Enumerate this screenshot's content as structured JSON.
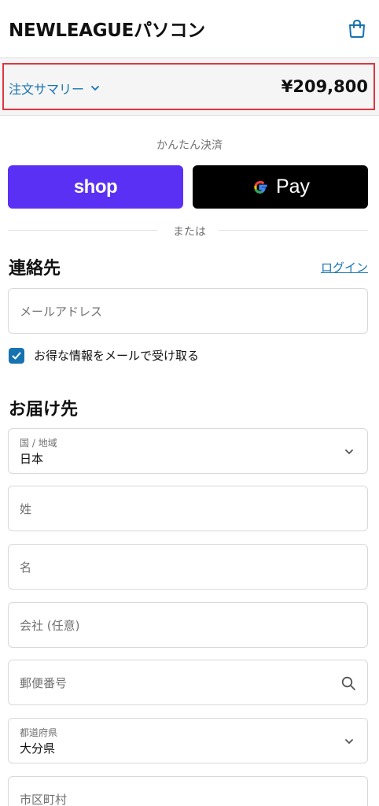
{
  "header": {
    "brand": "NEWLEAGUEパソコン",
    "cart_icon": "shopping-bag-icon"
  },
  "summary": {
    "toggle_label": "注文サマリー",
    "total": "¥209,800"
  },
  "express": {
    "title": "かんたん決済",
    "shop_label": "shop",
    "gpay_label": "Pay",
    "or_text": "または"
  },
  "contact": {
    "title": "連絡先",
    "login_label": "ログイン",
    "email_placeholder": "メールアドレス",
    "marketing_label": "お得な情報をメールで受け取る",
    "marketing_checked": true
  },
  "delivery": {
    "title": "お届け先",
    "country_label": "国 / 地域",
    "country_value": "日本",
    "last_name_placeholder": "姓",
    "first_name_placeholder": "名",
    "company_placeholder": "会社 (任意)",
    "postal_placeholder": "郵便番号",
    "prefecture_label": "都道府県",
    "prefecture_value": "大分県",
    "city_placeholder": "市区町村"
  },
  "colors": {
    "accent": "#1773b0",
    "shop_purple": "#5a31f4",
    "highlight_red": "#e0353f"
  }
}
